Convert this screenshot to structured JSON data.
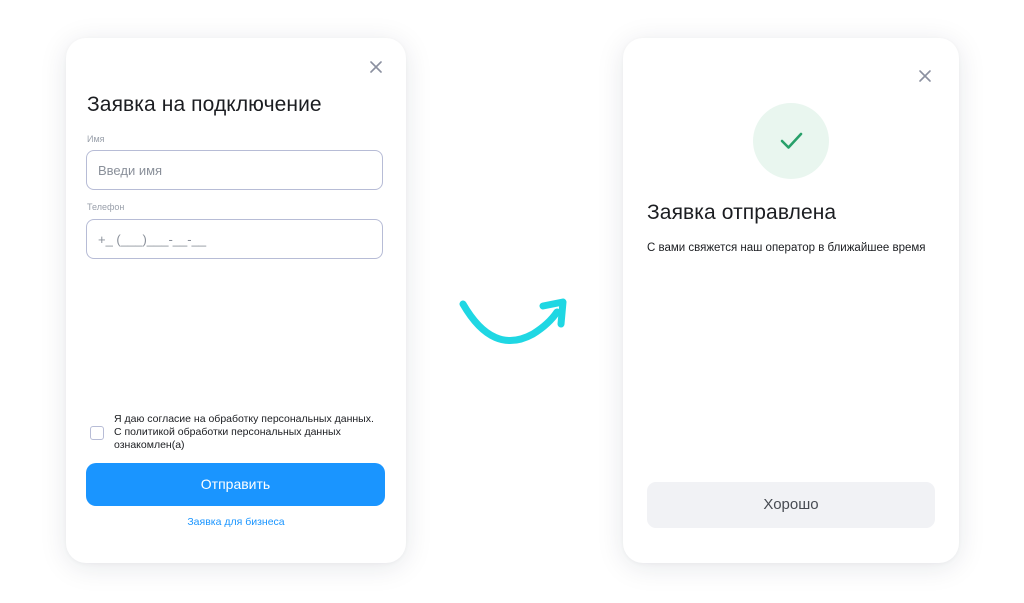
{
  "form": {
    "title": "Заявка на подключение",
    "name_label": "Имя",
    "name_placeholder": "Введи имя",
    "phone_label": "Телефон",
    "phone_placeholder": "+_ (___)___-__-__",
    "consent_text": "Я даю согласие на обработку персональных данных. С политикой обработки персональных данных ознакомлен(а)",
    "submit_label": "Отправить",
    "business_link": "Заявка для бизнеса",
    "close_icon": "close-icon"
  },
  "success": {
    "title": "Заявка отправлена",
    "message": "С вами свяжется наш оператор в ближайшее время",
    "ok_label": "Хорошо",
    "status_icon": "checkmark-icon",
    "close_icon": "close-icon"
  },
  "colors": {
    "accent": "#1a95ff",
    "success_green": "#28a06a",
    "success_bg": "#e9f6ef",
    "arrow": "#1fd7e3"
  }
}
